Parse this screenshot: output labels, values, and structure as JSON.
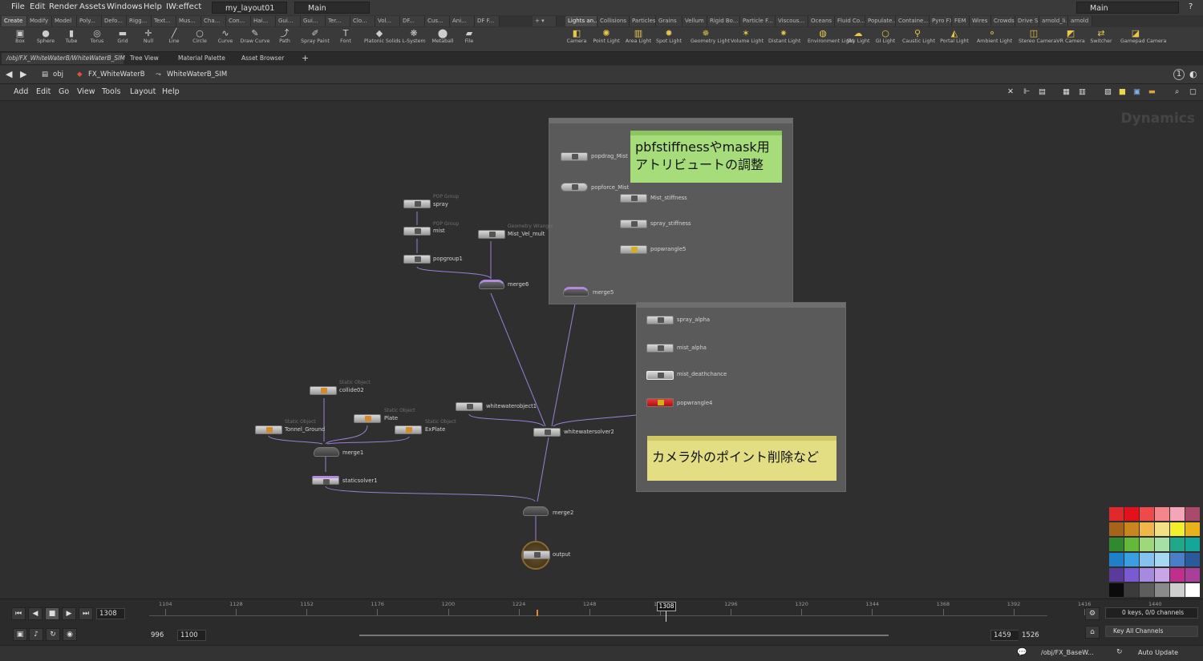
{
  "menubar": {
    "items": [
      "File",
      "Edit",
      "Render",
      "Assets",
      "Windows",
      "Help",
      "IW:effect"
    ],
    "desktop": "my_layout01",
    "context": "Main",
    "right_context": "Main",
    "help_glyph": "?"
  },
  "shelf": {
    "tabs_left": [
      "Create",
      "Modify",
      "Model",
      "Poly...",
      "Defo...",
      "Rigg...",
      "Text...",
      "Mus...",
      "Cha...",
      "Con...",
      "Hai...",
      "Gui...",
      "Gui...",
      "Ter...",
      "Clo...",
      "Vol...",
      "DF...",
      "Cus...",
      "Ani...",
      "DF F..."
    ],
    "tabs_right": [
      "Lights an...",
      "Collisions",
      "Particles",
      "Grains",
      "Vellum",
      "Rigid Bo...",
      "Particle F...",
      "Viscous...",
      "Oceans",
      "Fluid Co...",
      "Populate...",
      "Containe...",
      "Pyro FX",
      "FEM",
      "Wires",
      "Crowds",
      "Drive Si...",
      "arnold_li...",
      "arnold"
    ],
    "tools_left": [
      {
        "label": "Box",
        "icon": "box-icon",
        "glyph": "▣"
      },
      {
        "label": "Sphere",
        "icon": "sphere-icon",
        "glyph": "●"
      },
      {
        "label": "Tube",
        "icon": "tube-icon",
        "glyph": "▮"
      },
      {
        "label": "Torus",
        "icon": "torus-icon",
        "glyph": "◎"
      },
      {
        "label": "Grid",
        "icon": "grid-icon",
        "glyph": "▬"
      },
      {
        "label": "Null",
        "icon": "null-icon",
        "glyph": "✛"
      },
      {
        "label": "Line",
        "icon": "line-icon",
        "glyph": "╱"
      },
      {
        "label": "Circle",
        "icon": "circle-icon",
        "glyph": "○"
      },
      {
        "label": "Curve",
        "icon": "curve-icon",
        "glyph": "∿"
      },
      {
        "label": "Draw Curve",
        "icon": "draw-curve-icon",
        "glyph": "✎"
      },
      {
        "label": "Path",
        "icon": "path-icon",
        "glyph": "⤴"
      },
      {
        "label": "Spray Paint",
        "icon": "spray-paint-icon",
        "glyph": "✐"
      },
      {
        "label": "Font",
        "icon": "font-icon",
        "glyph": "T"
      },
      {
        "label": "Platonic Solids",
        "icon": "platonic-icon",
        "glyph": "◆"
      },
      {
        "label": "L-System",
        "icon": "lsystem-icon",
        "glyph": "❋"
      },
      {
        "label": "Metaball",
        "icon": "metaball-icon",
        "glyph": "⬤"
      },
      {
        "label": "File",
        "icon": "file-icon",
        "glyph": "▰"
      }
    ],
    "tools_right": [
      {
        "label": "Camera",
        "icon": "camera-icon",
        "glyph": "◧"
      },
      {
        "label": "Point Light",
        "icon": "point-light-icon",
        "glyph": "✺"
      },
      {
        "label": "Area Light",
        "icon": "area-light-icon",
        "glyph": "▥"
      },
      {
        "label": "Spot Light",
        "icon": "spot-light-icon",
        "glyph": "✹"
      },
      {
        "label": "Geometry Light",
        "icon": "geometry-light-icon",
        "glyph": "✵"
      },
      {
        "label": "Volume Light",
        "icon": "volume-light-icon",
        "glyph": "✶"
      },
      {
        "label": "Distant Light",
        "icon": "distant-light-icon",
        "glyph": "✷"
      },
      {
        "label": "Environment Light",
        "icon": "environment-light-icon",
        "glyph": "◍"
      },
      {
        "label": "Sky Light",
        "icon": "sky-light-icon",
        "glyph": "☁"
      },
      {
        "label": "GI Light",
        "icon": "gi-light-icon",
        "glyph": "○"
      },
      {
        "label": "Caustic Light",
        "icon": "caustic-light-icon",
        "glyph": "⚲"
      },
      {
        "label": "Portal Light",
        "icon": "portal-light-icon",
        "glyph": "◭"
      },
      {
        "label": "Ambient Light",
        "icon": "ambient-light-icon",
        "glyph": "⚬"
      },
      {
        "label": "Stereo Camera",
        "icon": "stereo-camera-icon",
        "glyph": "◫"
      },
      {
        "label": "VR Camera",
        "icon": "vr-camera-icon",
        "glyph": "◩"
      },
      {
        "label": "Switcher",
        "icon": "switcher-icon",
        "glyph": "⇄"
      },
      {
        "label": "Gamepad Camera",
        "icon": "gamepad-camera-icon",
        "glyph": "◪"
      }
    ]
  },
  "pane_tabs": [
    "/obj/FX_WhiteWaterB/WhiteWaterB_SIM",
    "Tree View",
    "Material Palette",
    "Asset Browser"
  ],
  "pathbar": {
    "crumbs": [
      "obj",
      "FX_WhiteWaterB",
      "WhiteWaterB_SIM"
    ]
  },
  "net_menu": [
    "Add",
    "Edit",
    "Go",
    "View",
    "Tools",
    "Layout",
    "Help"
  ],
  "network": {
    "context_label": "Dynamics",
    "sticky_notes": [
      {
        "text_line1": "pbfstiffnessやmask用",
        "text_line2": "アトリビュートの調整",
        "color": "#a6dd7a"
      },
      {
        "text_line1": "カメラ外のポイント削除など",
        "text_line2": "",
        "color": "#e3de84"
      }
    ],
    "nodes": [
      {
        "id": "spray",
        "label": "spray",
        "type": "POP Group"
      },
      {
        "id": "mist",
        "label": "mist",
        "type": "POP Group"
      },
      {
        "id": "popgroup1",
        "label": "popgroup1",
        "type": ""
      },
      {
        "id": "mist_vel_mult",
        "label": "Mist_Vel_mult",
        "type": "Geometry Wrangle"
      },
      {
        "id": "merge6",
        "label": "merge6",
        "type": ""
      },
      {
        "id": "popdrag_mist",
        "label": "popdrag_Mist",
        "type": ""
      },
      {
        "id": "popforce_mist",
        "label": "popforce_Mist",
        "type": ""
      },
      {
        "id": "mist_stiffness",
        "label": "Mist_stiffness",
        "type": ""
      },
      {
        "id": "spray_stiffness",
        "label": "spray_stiffness",
        "type": ""
      },
      {
        "id": "popwrangle5",
        "label": "popwrangle5",
        "type": ""
      },
      {
        "id": "merge5",
        "label": "merge5",
        "type": ""
      },
      {
        "id": "spray_alpha",
        "label": "spray_alpha",
        "type": ""
      },
      {
        "id": "mist_alpha",
        "label": "mist_alpha",
        "type": ""
      },
      {
        "id": "mist_deathchance",
        "label": "mist_deathchance",
        "type": ""
      },
      {
        "id": "popwrangle4",
        "label": "popwrangle4",
        "type": ""
      },
      {
        "id": "collide02",
        "label": "collide02",
        "type": "Static Object"
      },
      {
        "id": "tonnel_ground",
        "label": "Tonnel_Ground",
        "type": "Static Object"
      },
      {
        "id": "plate",
        "label": "Plate",
        "type": "Static Object"
      },
      {
        "id": "explate",
        "label": "ExPlate",
        "type": "Static Object"
      },
      {
        "id": "merge1",
        "label": "merge1",
        "type": ""
      },
      {
        "id": "staticsolver1",
        "label": "staticsolver1",
        "type": ""
      },
      {
        "id": "whitewaterobject1",
        "label": "whitewaterobject1",
        "type": ""
      },
      {
        "id": "whitewatersolver2",
        "label": "whitewatersolver2",
        "type": ""
      },
      {
        "id": "merge2",
        "label": "merge2",
        "type": ""
      },
      {
        "id": "output",
        "label": "output",
        "type": ""
      }
    ]
  },
  "palette": {
    "colors": [
      "#e0292b",
      "#e3121a",
      "#ef4a4a",
      "#f2868b",
      "#f4a5b8",
      "#a94a6a",
      "#a8631b",
      "#c8861c",
      "#f0b64a",
      "#f3df86",
      "#f4ef2b",
      "#e8b21a",
      "#2f8a2f",
      "#64b83a",
      "#9fd87a",
      "#a6e0a6",
      "#1fa88a",
      "#15a69a",
      "#1f7fc8",
      "#3a9ee0",
      "#86c2ee",
      "#a6d8f4",
      "#4a7ec8",
      "#2a5a9a",
      "#5a3a9a",
      "#7a5ad0",
      "#a68ae0",
      "#c7a6e8",
      "#c0308a",
      "#a8409a",
      "#0b0b0b",
      "#3b3b3b",
      "#5d5d5d",
      "#8a8a8a",
      "#cfcfcf",
      "#ffffff"
    ]
  },
  "timeline": {
    "current_frame": "1308",
    "range_start": "996",
    "range_start2": "1100",
    "range_end": "1459",
    "range_end2": "1526",
    "ticks": [
      "1104",
      "1128",
      "1152",
      "1176",
      "1200",
      "1224",
      "1248",
      "1272",
      "1296",
      "1320",
      "1344",
      "1368",
      "1392",
      "1416",
      "1440"
    ],
    "keys_info": "0 keys, 0/0 channels",
    "key_all": "Key All Channels"
  },
  "statusbar": {
    "path": "/obj/FX_BaseW...",
    "auto_update": "Auto Update"
  }
}
